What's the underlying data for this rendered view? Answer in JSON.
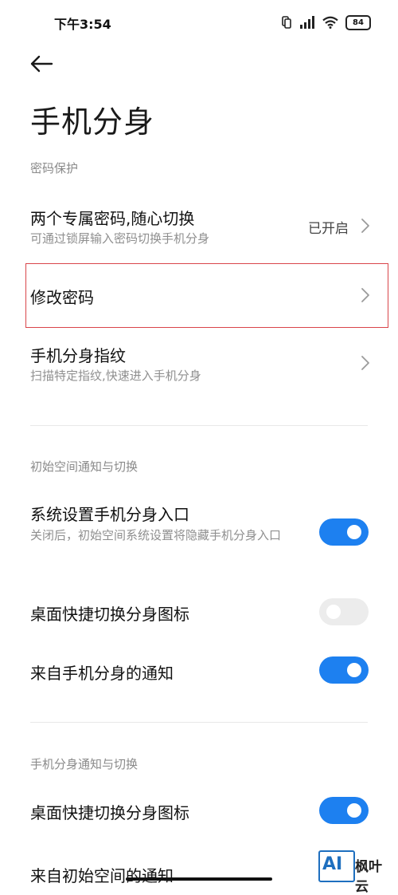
{
  "status_bar": {
    "time": "下午3:54",
    "battery": "84",
    "icons": [
      "vibrate-icon",
      "signal-icon",
      "wifi-icon",
      "battery-icon"
    ]
  },
  "header": {
    "title": "手机分身",
    "back_icon": "arrow-left-icon"
  },
  "sections": [
    {
      "header": "密码保护",
      "items": [
        {
          "title": "两个专属密码,随心切换",
          "subtitle": "可通过锁屏输入密码切换手机分身",
          "value": "已开启"
        },
        {
          "title": "修改密码",
          "highlighted": true
        },
        {
          "title": "手机分身指纹",
          "subtitle": "扫描特定指纹,快速进入手机分身"
        }
      ]
    },
    {
      "header": "初始空间通知与切换",
      "items": [
        {
          "title": "系统设置手机分身入口",
          "subtitle": "关闭后，初始空间系统设置将隐藏手机分身入口",
          "toggle": true
        },
        {
          "title": "桌面快捷切换分身图标",
          "toggle": false
        },
        {
          "title": "来自手机分身的通知",
          "toggle": true
        }
      ]
    },
    {
      "header": "手机分身通知与切换",
      "items": [
        {
          "title": "桌面快捷切换分身图标",
          "toggle": true
        },
        {
          "title": "来自初始空间的通知"
        }
      ]
    }
  ],
  "watermark": {
    "mark": "AI",
    "text": "枫叶云"
  },
  "colors": {
    "accent": "#1d80f0",
    "toggle_off": "#ececec",
    "highlight_border": "#d9454a",
    "section_header": "#8a8a8a",
    "subtitle": "#8f8f8f"
  }
}
